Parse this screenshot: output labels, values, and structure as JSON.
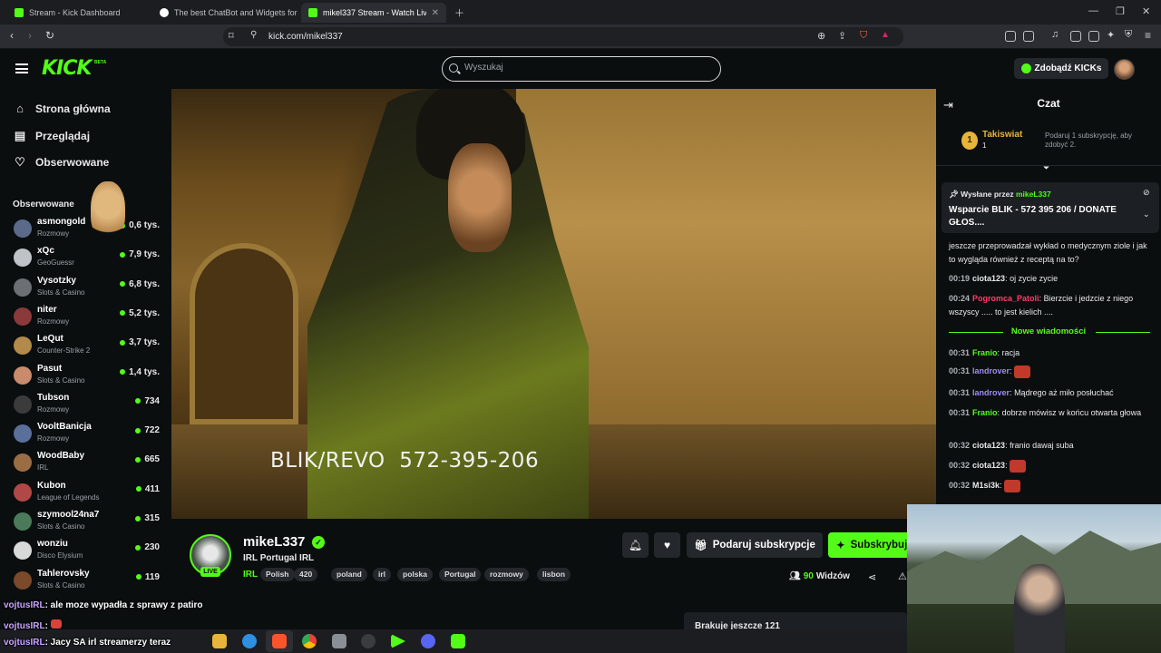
{
  "browser": {
    "tabs": [
      {
        "title": "Stream - Kick Dashboard",
        "favicon_color": "#53fc18"
      },
      {
        "title": "The best ChatBot and Widgets for Kick",
        "favicon_color": "#ffffff"
      },
      {
        "title": "mikel337 Stream - Watch Live",
        "favicon_color": "#53fc18"
      }
    ],
    "url": "kick.com/mikel337"
  },
  "header": {
    "logo": "KICK",
    "logo_badge": "BETA",
    "search_placeholder": "Wyszukaj",
    "get_kicks": "Zdobądź KICKs"
  },
  "sidebar": {
    "nav": [
      {
        "label": "Strona główna",
        "icon": "home-icon"
      },
      {
        "label": "Przeglądaj",
        "icon": "browse-icon"
      },
      {
        "label": "Obserwowane",
        "icon": "heart-icon"
      }
    ],
    "followed_title": "Obserwowane",
    "channels": [
      {
        "name": "asmongold",
        "category": "Rozmowy",
        "viewers": "0,6 tys.",
        "color": "#5b6a8a"
      },
      {
        "name": "xQc",
        "category": "GeoGuessr",
        "viewers": "7,9 tys.",
        "color": "#bfc3c7"
      },
      {
        "name": "Vysotzky",
        "category": "Slots & Casino",
        "viewers": "6,8 tys.",
        "color": "#6c6f73"
      },
      {
        "name": "niter",
        "category": "Rozmowy",
        "viewers": "5,2 tys.",
        "color": "#8a3a3a"
      },
      {
        "name": "LeQut",
        "category": "Counter-Strike 2",
        "viewers": "3,7 tys.",
        "color": "#b38a4a"
      },
      {
        "name": "Pasut",
        "category": "Slots & Casino",
        "viewers": "1,4 tys.",
        "color": "#c98b6b"
      },
      {
        "name": "Tubson",
        "category": "Rozmowy",
        "viewers": "734",
        "color": "#3b3b3b"
      },
      {
        "name": "VooltBanicja",
        "category": "Rozmowy",
        "viewers": "722",
        "color": "#5a6f9a"
      },
      {
        "name": "WoodBaby",
        "category": "IRL",
        "viewers": "665",
        "color": "#9a6d45"
      },
      {
        "name": "Kubon",
        "category": "League of Legends",
        "viewers": "411",
        "color": "#b04848"
      },
      {
        "name": "szymool24na7",
        "category": "Slots & Casino",
        "viewers": "315",
        "color": "#4a7a5a"
      },
      {
        "name": "wonziu",
        "category": "Disco Elysium",
        "viewers": "230",
        "color": "#d9d9d9"
      },
      {
        "name": "Tahlerovsky",
        "category": "Slots & Casino",
        "viewers": "119",
        "color": "#7a4a2a"
      }
    ]
  },
  "video": {
    "overlay_text": "BLIK/REVO  572-395-206"
  },
  "stream": {
    "streamer": "mikeL337",
    "live": "LIVE",
    "title": "IRL Portugal IRL",
    "category": "IRL",
    "tags": [
      "Polish",
      "420",
      "poland",
      "irl",
      "polska",
      "Portugal",
      "rozmowy",
      "lisbon"
    ],
    "gift_label": "Podaruj subskrypcje",
    "subscribe_label": "Subskrybuj",
    "viewers_count": "90",
    "viewers_label": "Widzów",
    "next_card": "Brakuje jeszcze 121"
  },
  "chat": {
    "title": "Czat",
    "top_gifter": {
      "rank": "1",
      "name": "Takiswiat",
      "count": "1",
      "hint": "Podaruj 1 subskrypcję, aby zdobyć 2."
    },
    "pinned": {
      "prefix": "Wysłane przez",
      "user": "mikeL337",
      "message": "Wsparcie BLIK - 572 395 206 / DONATE GŁOS...."
    },
    "messages": [
      {
        "time": "",
        "user": "",
        "user_color": "#e7e8e9",
        "text": "jeszcze przeprowadzał wykład o medycznym ziole i jak to wygląda również z receptą na to?"
      },
      {
        "time": "00:19",
        "user": "ciota123",
        "user_color": "#e7e8e9",
        "text": "oj zycie zycie"
      },
      {
        "time": "00:24",
        "user": "Pogromca_Patoli",
        "user_color": "#ff3b6b",
        "text": "Bierzcie i jedzcie z niego wszyscy ..... to jest kielich ...."
      },
      {
        "time": "00:31",
        "user": "Franio",
        "user_color": "#53fc18",
        "text": "racja"
      },
      {
        "time": "00:31",
        "user": "landrover",
        "user_color": "#9b8cff",
        "text": ""
      },
      {
        "time": "00:31",
        "user": "landrover",
        "user_color": "#9b8cff",
        "text": "Mądrego aż miło posłuchać"
      },
      {
        "time": "00:31",
        "user": "Franio",
        "user_color": "#53fc18",
        "text": "dobrze mówisz w końcu otwarta głowa"
      },
      {
        "time": "00:32",
        "user": "ciota123",
        "user_color": "#e7e8e9",
        "text": "franio dawaj suba"
      },
      {
        "time": "00:32",
        "user": "ciota123",
        "user_color": "#e7e8e9",
        "text": ""
      },
      {
        "time": "00:32",
        "user": "M1si3k",
        "user_color": "#e7e8e9",
        "text": ""
      }
    ],
    "new_messages": "Nowe wiadomości"
  },
  "overlay_chat": [
    {
      "user": "vojtusIRL",
      "text": "ale moze wypadła z sprawy z patiro"
    },
    {
      "user": "vojtusIRL",
      "text": ""
    },
    {
      "user": "vojtusIRL",
      "text": "Jacy SA irl streamerzy teraz"
    }
  ]
}
